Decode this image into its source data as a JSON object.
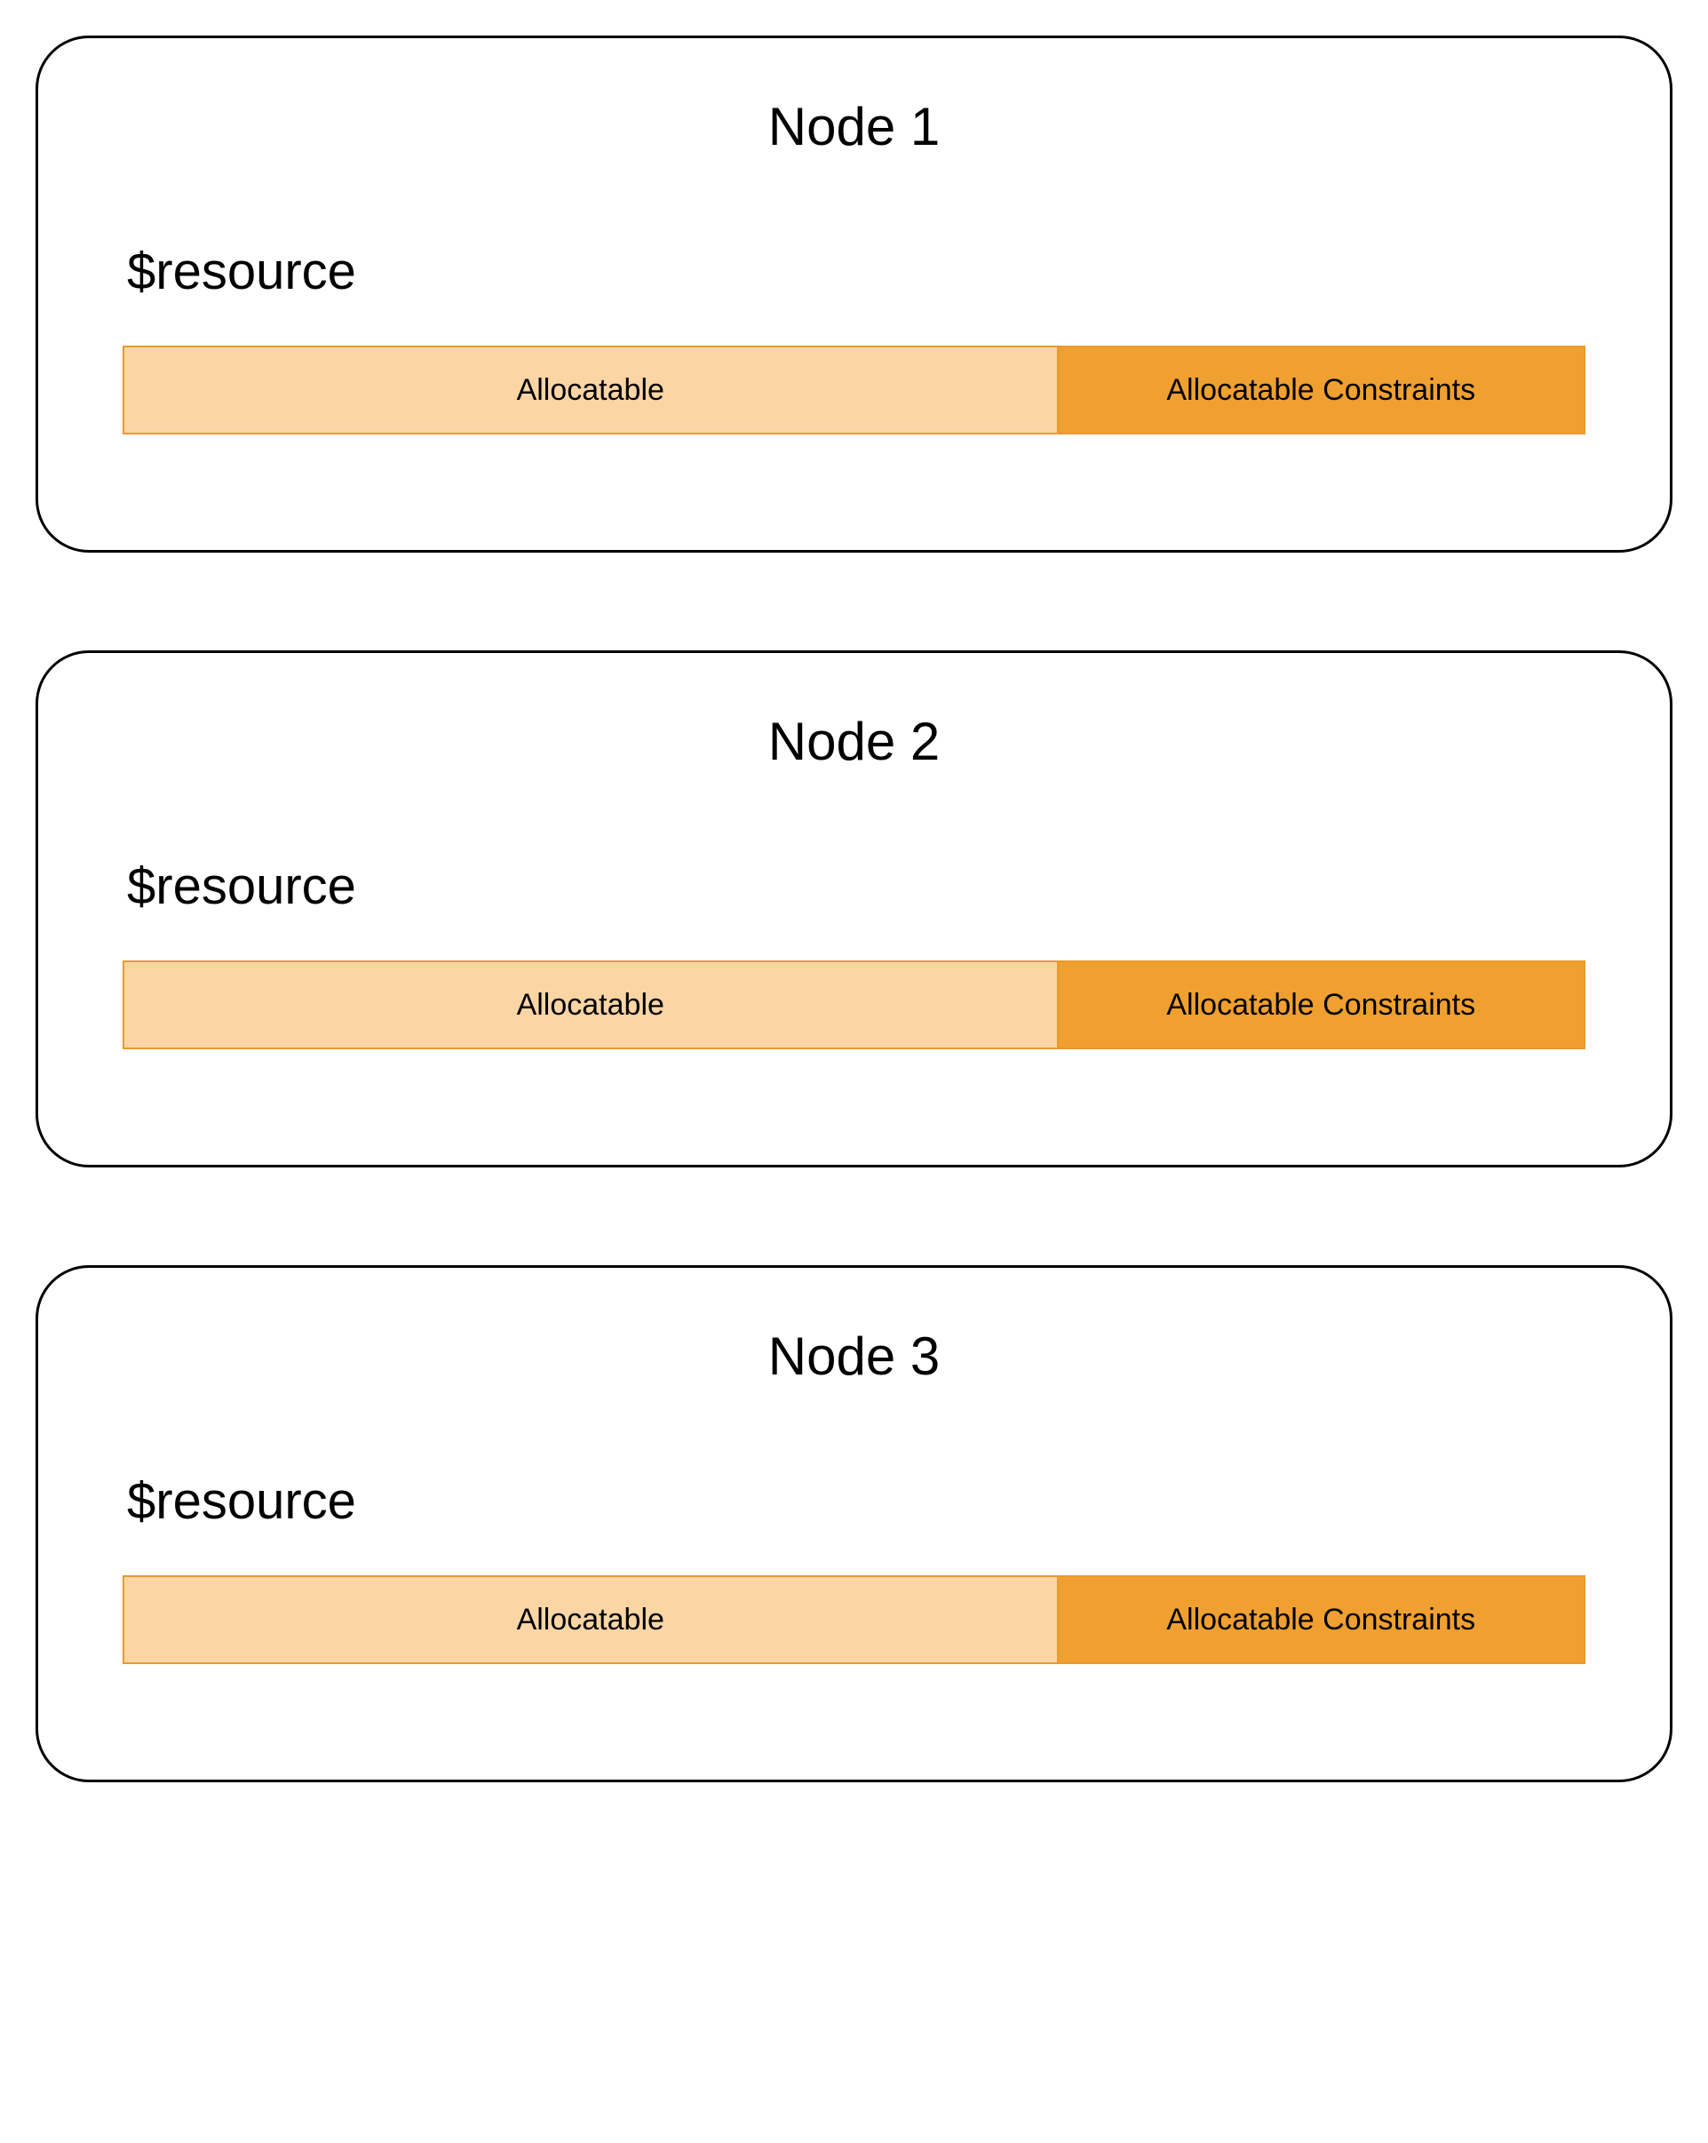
{
  "nodes": [
    {
      "title": "Node 1",
      "resource_label": "$resource",
      "allocatable_label": "Allocatable",
      "constraints_label": "Allocatable Constraints",
      "allocatable_percent": 64,
      "constraints_percent": 36
    },
    {
      "title": "Node 2",
      "resource_label": "$resource",
      "allocatable_label": "Allocatable",
      "constraints_label": "Allocatable Constraints",
      "allocatable_percent": 64,
      "constraints_percent": 36
    },
    {
      "title": "Node 3",
      "resource_label": "$resource",
      "allocatable_label": "Allocatable",
      "constraints_label": "Allocatable Constraints",
      "allocatable_percent": 64,
      "constraints_percent": 36
    }
  ],
  "colors": {
    "allocatable_bg": "#fcd5a5",
    "constraints_bg": "#f0a030",
    "bar_border": "#e89a2e",
    "card_border": "#000000"
  }
}
